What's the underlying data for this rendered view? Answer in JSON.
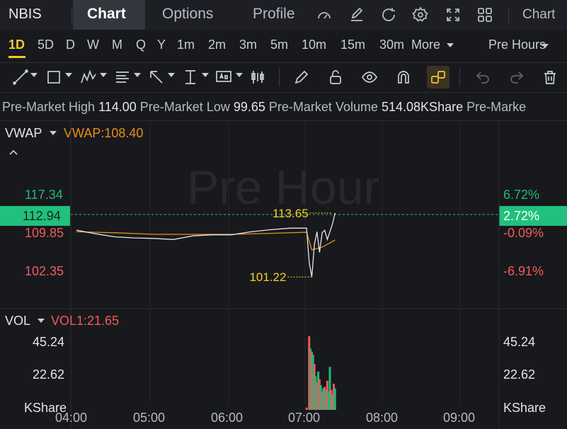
{
  "topbar": {
    "symbol": "NBIS",
    "tabs": [
      "Chart",
      "Options",
      "Profile"
    ],
    "active_tab": "Chart",
    "chart_menu": "Chart",
    "icons": [
      "gauge-icon",
      "edit-icon",
      "refresh-icon",
      "settings-icon",
      "fullscreen-icon",
      "layout-icon"
    ]
  },
  "periods": {
    "items": [
      "1D",
      "5D",
      "D",
      "W",
      "M",
      "Q",
      "Y",
      "1m",
      "2m",
      "3m",
      "5m",
      "10m",
      "15m",
      "30m"
    ],
    "active": "1D",
    "more": "More",
    "session": "Pre Hours"
  },
  "drawbar": {
    "icons": [
      "line-tool-icon",
      "rectangle-tool-icon",
      "pattern-tool-icon",
      "fib-tool-icon",
      "arrow-tool-icon",
      "measure-tool-icon",
      "text-tool-icon",
      "candle-tool-icon",
      "pencil-icon",
      "lock-icon",
      "eye-icon",
      "magnet-icon",
      "link-icon",
      "undo-icon",
      "redo-icon",
      "trash-icon"
    ],
    "active_icon": "link-icon"
  },
  "info": {
    "high_label": "Pre-Market High",
    "high_value": "114.00",
    "low_label": "Pre-Market Low",
    "low_value": "99.65",
    "volume_label": "Pre-Market Volume",
    "volume_value": "514.08KShare",
    "trailing": "Pre-Marke"
  },
  "price_pane": {
    "indicator": "VWAP",
    "indicator_value": "VWAP:108.40",
    "watermark": "Pre Hour",
    "left_ticks": [
      "117.34",
      "112.94",
      "109.85",
      "102.35"
    ],
    "right_ticks": [
      "6.72%",
      "2.72%",
      "-0.09%",
      "-6.91%"
    ],
    "high_marker": "113.65",
    "low_marker": "101.22",
    "colors": {
      "up": "#21b77a",
      "down": "#f05b5b",
      "vwap": "#e88d1a",
      "price_line": "#e3e5ea",
      "current_price": "#21c07c",
      "marker": "#f5d023"
    }
  },
  "volume_pane": {
    "indicator": "VOL",
    "indicator_value": "VOL1:21.65",
    "left_ticks": [
      "45.24",
      "22.62",
      "KShare"
    ],
    "right_ticks": [
      "45.24",
      "22.62",
      "KShare"
    ]
  },
  "x_axis": {
    "labels": [
      "04:00",
      "05:00",
      "06:00",
      "07:00",
      "08:00",
      "09:00"
    ]
  },
  "chart_data": [
    {
      "type": "line",
      "title": "",
      "series": [
        {
          "name": "VWAP",
          "x": [
            "04:00",
            "04:30",
            "05:00",
            "05:30",
            "06:00",
            "06:30",
            "06:58",
            "07:02",
            "07:10",
            "07:20"
          ],
          "values": [
            110.0,
            109.8,
            109.5,
            109.5,
            109.5,
            109.7,
            109.9,
            106.5,
            107.0,
            108.4
          ]
        },
        {
          "x": [
            "04:00",
            "04:15",
            "04:30",
            "04:45",
            "05:00",
            "05:15",
            "05:30",
            "05:45",
            "06:00",
            "06:15",
            "06:30",
            "06:45",
            "06:58",
            "07:00",
            "07:02",
            "07:04",
            "07:06",
            "07:08",
            "07:10",
            "07:12",
            "07:14",
            "07:16",
            "07:18",
            "07:20"
          ],
          "values": [
            110.3,
            109.6,
            109.0,
            108.8,
            108.7,
            108.5,
            109.2,
            109.4,
            109.4,
            110.0,
            110.4,
            110.7,
            110.7,
            104.0,
            101.22,
            107.5,
            110.0,
            106.0,
            109.8,
            110.3,
            108.5,
            110.0,
            111.5,
            113.65
          ]
        }
      ],
      "ylim": [
        100.0,
        120.0
      ],
      "right_axis_percent": [
        "6.72%",
        "2.72%",
        "-0.09%",
        "-6.91%"
      ],
      "current_price": 112.94
    },
    {
      "type": "bar",
      "title": "",
      "series": [
        {
          "x": [
            "06:58",
            "07:00",
            "07:01",
            "07:02",
            "07:03",
            "07:04",
            "07:05",
            "07:06",
            "07:07",
            "07:08",
            "07:09",
            "07:10",
            "07:11",
            "07:12",
            "07:13",
            "07:14",
            "07:15",
            "07:16",
            "07:17",
            "07:18",
            "07:19",
            "07:20"
          ],
          "values": [
            1.5,
            48,
            40,
            38,
            36,
            30,
            22,
            18,
            25,
            20,
            16,
            12,
            14,
            15,
            13,
            19,
            12,
            28,
            13,
            10,
            17,
            14
          ],
          "up": [
            false,
            false,
            true,
            false,
            true,
            false,
            true,
            false,
            true,
            false,
            true,
            false,
            true,
            false,
            true,
            false,
            true,
            true,
            false,
            true,
            false,
            true
          ]
        }
      ],
      "ylim": [
        0,
        55
      ]
    }
  ]
}
